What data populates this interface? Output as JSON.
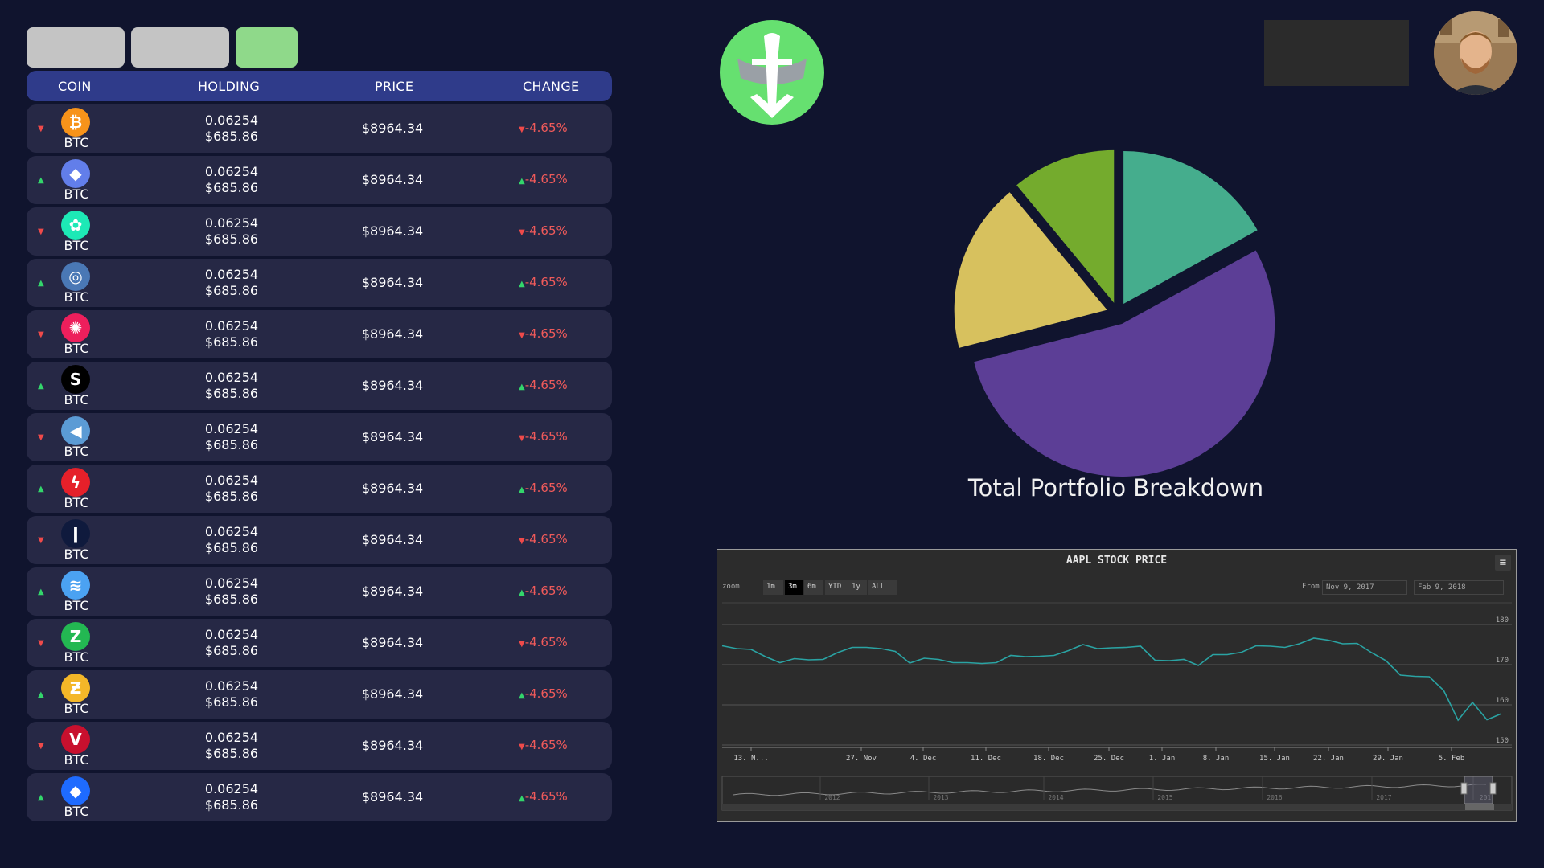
{
  "table": {
    "headers": {
      "coin": "COIN",
      "holding": "HOLDING",
      "price": "PRICE",
      "change": "CHANGE"
    },
    "rows": [
      {
        "dir": "down",
        "arrow": "▼",
        "icon": "bitcoin-icon",
        "icon_color": "#f7931a",
        "icon_glyph": "₿",
        "symbol": "BTC",
        "amount": "0.06254",
        "value": "$685.86",
        "price": "$8964.34",
        "change": "-4.65%"
      },
      {
        "dir": "up",
        "arrow": "▲",
        "icon": "ethereum-icon",
        "icon_color": "#627eea",
        "icon_glyph": "◆",
        "symbol": "BTC",
        "amount": "0.06254",
        "value": "$685.86",
        "price": "$8964.34",
        "change": "-4.65%"
      },
      {
        "dir": "down",
        "arrow": "▼",
        "icon": "bancor-icon",
        "icon_color": "#1de9b6",
        "icon_glyph": "✿",
        "symbol": "BTC",
        "amount": "0.06254",
        "value": "$685.86",
        "price": "$8964.34",
        "change": "-4.65%"
      },
      {
        "dir": "up",
        "arrow": "▲",
        "icon": "globe-coin-icon",
        "icon_color": "#4a78b5",
        "icon_glyph": "◎",
        "symbol": "BTC",
        "amount": "0.06254",
        "value": "$685.86",
        "price": "$8964.34",
        "change": "-4.65%"
      },
      {
        "dir": "down",
        "arrow": "▼",
        "icon": "funfair-icon",
        "icon_color": "#ed1f5c",
        "icon_glyph": "✺",
        "symbol": "BTC",
        "amount": "0.06254",
        "value": "$685.86",
        "price": "$8964.34",
        "change": "-4.65%"
      },
      {
        "dir": "up",
        "arrow": "▲",
        "icon": "s-coin-icon",
        "icon_color": "#000000",
        "icon_glyph": "S",
        "symbol": "BTC",
        "amount": "0.06254",
        "value": "$685.86",
        "price": "$8964.34",
        "change": "-4.65%"
      },
      {
        "dir": "down",
        "arrow": "▼",
        "icon": "telegram-icon",
        "icon_color": "#5b9bd5",
        "icon_glyph": "◀",
        "symbol": "BTC",
        "amount": "0.06254",
        "value": "$685.86",
        "price": "$8964.34",
        "change": "-4.65%"
      },
      {
        "dir": "up",
        "arrow": "▲",
        "icon": "tron-icon",
        "icon_color": "#e5202a",
        "icon_glyph": "ϟ",
        "symbol": "BTC",
        "amount": "0.06254",
        "value": "$685.86",
        "price": "$8964.34",
        "change": "-4.65%"
      },
      {
        "dir": "down",
        "arrow": "▼",
        "icon": "candle-coin-icon",
        "icon_color": "#0f1a3d",
        "icon_glyph": "ǀ",
        "symbol": "BTC",
        "amount": "0.06254",
        "value": "$685.86",
        "price": "$8964.34",
        "change": "-4.65%"
      },
      {
        "dir": "up",
        "arrow": "▲",
        "icon": "steem-icon",
        "icon_color": "#4ba2f2",
        "icon_glyph": "≋",
        "symbol": "BTC",
        "amount": "0.06254",
        "value": "$685.86",
        "price": "$8964.34",
        "change": "-4.65%"
      },
      {
        "dir": "down",
        "arrow": "▼",
        "icon": "zcoin-icon",
        "icon_color": "#23b852",
        "icon_glyph": "Z",
        "symbol": "BTC",
        "amount": "0.06254",
        "value": "$685.86",
        "price": "$8964.34",
        "change": "-4.65%"
      },
      {
        "dir": "up",
        "arrow": "▲",
        "icon": "zcash-icon",
        "icon_color": "#f4b728",
        "icon_glyph": "Ƶ",
        "symbol": "BTC",
        "amount": "0.06254",
        "value": "$685.86",
        "price": "$8964.34",
        "change": "-4.65%"
      },
      {
        "dir": "down",
        "arrow": "▼",
        "icon": "verge-icon",
        "icon_color": "#c8102e",
        "icon_glyph": "V",
        "symbol": "BTC",
        "amount": "0.06254",
        "value": "$685.86",
        "price": "$8964.34",
        "change": "-4.65%"
      },
      {
        "dir": "up",
        "arrow": "▲",
        "icon": "diamond-coin-icon",
        "icon_color": "#1e6bff",
        "icon_glyph": "◆",
        "symbol": "BTC",
        "amount": "0.06254",
        "value": "$685.86",
        "price": "$8964.34",
        "change": "-4.65%"
      }
    ]
  },
  "colors": {
    "background": "#10142e",
    "header": "#2f3b8a",
    "row": "#262845",
    "positive": "#33d66b",
    "negative": "#ef4a4a",
    "logo": "#66e070"
  },
  "portfolio": {
    "title": "Total Portfolio Breakdown",
    "chart_data": {
      "type": "pie",
      "slices": [
        {
          "value": 17,
          "color": "#45ad8d"
        },
        {
          "value": 54,
          "color": "#5c3e96"
        },
        {
          "value": 18,
          "color": "#d7c15e"
        },
        {
          "value": 11,
          "color": "#74ab2d"
        }
      ]
    }
  },
  "stock": {
    "title": "AAPL STOCK PRICE",
    "zoom_label": "zoom",
    "zoom_buttons": [
      "1m",
      "3m",
      "6m",
      "YTD",
      "1y",
      "ALL"
    ],
    "zoom_active": "3m",
    "from_label": "From",
    "from_date": "Nov 9, 2017",
    "to_date": "Feb 9, 2018",
    "menu_icon": "hamburger-menu-icon",
    "chart_data": {
      "type": "line",
      "x_ticks": [
        "13. N...",
        "27. Nov",
        "4. Dec",
        "11. Dec",
        "18. Dec",
        "25. Dec",
        "1. Jan",
        "8. Jan",
        "15. Jan",
        "22. Jan",
        "29. Jan",
        "5. Feb"
      ],
      "y_ticks": [
        180,
        170,
        160,
        150
      ],
      "ylim": [
        150,
        185
      ],
      "values": [
        174.7,
        174,
        173.8,
        172,
        170.5,
        171.5,
        171.2,
        171.3,
        173,
        174.3,
        174.3,
        174,
        173.3,
        170.4,
        171.6,
        171.3,
        170.5,
        170.5,
        170.3,
        170.5,
        172.3,
        172,
        172.1,
        172.3,
        173.5,
        175,
        174,
        174.2,
        174.3,
        174.6,
        171.1,
        171,
        171.3,
        169.8,
        172.5,
        172.5,
        173.1,
        174.7,
        174.6,
        174.3,
        175.2,
        176.6,
        176.1,
        175.2,
        175.3,
        173,
        171,
        167.4,
        167.1,
        167,
        163.6,
        156.2,
        160.6,
        156.3,
        157.8
      ],
      "navigator_labels": [
        "2012",
        "2013",
        "2014",
        "2015",
        "2016",
        "2017",
        "201"
      ]
    }
  },
  "avatar": {
    "icon": "user-avatar-photo"
  },
  "logo": {
    "icon": "app-logo-icon"
  }
}
